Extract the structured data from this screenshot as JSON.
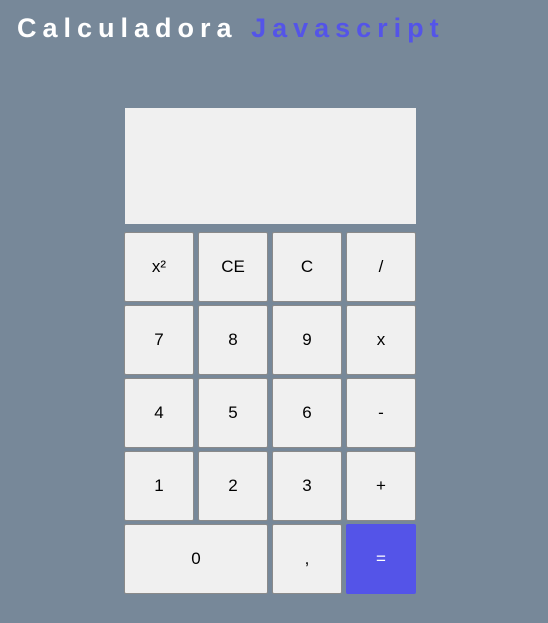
{
  "title": {
    "part1": "Calculadora",
    "part2": "Javascript"
  },
  "display": {
    "value": ""
  },
  "buttons": [
    "x²",
    "CE",
    "C",
    "/",
    "7",
    "8",
    "9",
    "x",
    "4",
    "5",
    "6",
    "-",
    "1",
    "2",
    "3",
    "+",
    "0",
    ",",
    "="
  ],
  "colors": {
    "background": "#778899",
    "accent": "#5454e8"
  }
}
